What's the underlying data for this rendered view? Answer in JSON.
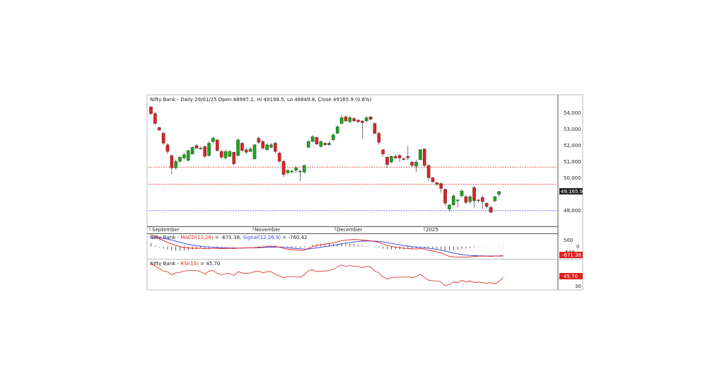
{
  "header": {
    "title": "Nifty Bank - Daily 29/01/25 Open 48997.2, Hi 49198.5, Lo 48849.8, Close 49165.9 (0.6%)"
  },
  "price_panel": {
    "y_ticks": [
      "54,000",
      "53,000",
      "52,000",
      "51,000",
      "50,000",
      "48,000"
    ],
    "last_price_label": "49,165.9"
  },
  "x_axis": {
    "labels": [
      "September",
      "November",
      "December",
      "2025"
    ]
  },
  "macd_panel": {
    "prefix": "Nifty Bank - ",
    "macd_label": "MACD(12,26)",
    "macd_value": " = -671.38, ",
    "signal_label": "Signal(12,26,9)",
    "signal_value": " = -760.42",
    "y_ticks": [
      "500",
      "0",
      "-500"
    ],
    "badge": "-671.38"
  },
  "rsi_panel": {
    "prefix": "Nifty Bank - ",
    "rsi_label": "RSI(15)",
    "rsi_value": " = 45.70",
    "y_ticks": [
      "30"
    ],
    "badge": "45.70"
  },
  "colors": {
    "up": "#19a619",
    "down": "#e02020",
    "macd": "#e02020",
    "signal": "#3b3bdf",
    "rsi": "#e02020",
    "ref_red": "#e02020",
    "ref_blue": "#3b3bdf",
    "badge_bg": "#e02020",
    "price_badge_bg": "#222222"
  },
  "chart_data": [
    {
      "type": "candlestick",
      "title": "Nifty Bank - Daily 29/01/25 Open 48997.2, Hi 49198.5, Lo 48849.8, Close 49165.9 (0.6%)",
      "ylim": [
        47050,
        55000
      ],
      "reference_lines": [
        {
          "value": 50650,
          "color": "red",
          "style": "dotted"
        },
        {
          "value": 49600,
          "color": "red",
          "style": "dotted"
        },
        {
          "value": 48000,
          "color": "blue",
          "style": "dotted"
        }
      ],
      "candles": [
        [
          54300,
          53900,
          54350,
          53800
        ],
        [
          53900,
          53300,
          54000,
          53200
        ],
        [
          53050,
          52900,
          53100,
          52850
        ],
        [
          52700,
          52100,
          52800,
          52000
        ],
        [
          52000,
          51600,
          52100,
          51450
        ],
        [
          51350,
          50600,
          51400,
          50200
        ],
        [
          50600,
          51000,
          51100,
          50500
        ],
        [
          51000,
          51250,
          51300,
          50900
        ],
        [
          51200,
          51400,
          51500,
          51100
        ],
        [
          51050,
          51650,
          51700,
          51000
        ],
        [
          51450,
          51850,
          51900,
          51400
        ],
        [
          51950,
          51800,
          52050,
          51750
        ],
        [
          51750,
          51800,
          51900,
          51700
        ],
        [
          51900,
          51300,
          51950,
          51200
        ],
        [
          51350,
          52100,
          52200,
          51300
        ],
        [
          52200,
          52400,
          52500,
          52100
        ],
        [
          52300,
          51650,
          52350,
          51600
        ],
        [
          51600,
          51250,
          51700,
          51150
        ],
        [
          51200,
          51600,
          51700,
          51100
        ],
        [
          51300,
          51600,
          51700,
          51250
        ],
        [
          51550,
          50850,
          51600,
          50750
        ],
        [
          51350,
          52300,
          52400,
          51300
        ],
        [
          52100,
          51650,
          52150,
          51600
        ],
        [
          51700,
          51550,
          51800,
          51450
        ],
        [
          51600,
          51750,
          51850,
          51550
        ],
        [
          51150,
          52000,
          52050,
          51100
        ],
        [
          52400,
          52150,
          52500,
          52050
        ],
        [
          52200,
          51800,
          52300,
          51700
        ],
        [
          51700,
          52000,
          52100,
          51650
        ],
        [
          51850,
          52000,
          52100,
          51800
        ],
        [
          52100,
          51600,
          52200,
          51500
        ],
        [
          51500,
          51000,
          51600,
          50900
        ],
        [
          51000,
          50200,
          51050,
          50050
        ],
        [
          50300,
          50450,
          50500,
          50200
        ],
        [
          50350,
          50400,
          50500,
          50250
        ],
        [
          50450,
          50600,
          50700,
          50300
        ],
        [
          50350,
          50400,
          50500,
          49800
        ],
        [
          50350,
          50750,
          50800,
          50250
        ],
        [
          51850,
          52200,
          52300,
          51800
        ],
        [
          52200,
          52500,
          52600,
          52150
        ],
        [
          52450,
          52050,
          52500,
          52000
        ],
        [
          51900,
          52200,
          52300,
          51850
        ],
        [
          52100,
          52000,
          52150,
          51950
        ],
        [
          52000,
          52100,
          52200,
          51950
        ],
        [
          52300,
          52600,
          52700,
          52250
        ],
        [
          52700,
          53100,
          53200,
          52650
        ],
        [
          53300,
          53650,
          53800,
          53250
        ],
        [
          53700,
          53450,
          53800,
          53400
        ],
        [
          53400,
          53650,
          53750,
          53350
        ],
        [
          53600,
          53450,
          53700,
          53400
        ],
        [
          53500,
          53400,
          53550,
          53350
        ],
        [
          53450,
          53350,
          53500,
          52400
        ],
        [
          53450,
          53650,
          53750,
          53400
        ],
        [
          53700,
          53550,
          53750,
          53500
        ],
        [
          53300,
          52700,
          53350,
          52650
        ],
        [
          52700,
          52150,
          52800,
          52000
        ],
        [
          51700,
          51450,
          51750,
          51300
        ],
        [
          51250,
          50800,
          51300,
          50600
        ],
        [
          50950,
          51300,
          51350,
          50900
        ],
        [
          51300,
          51200,
          51400,
          51150
        ],
        [
          51350,
          51200,
          51450,
          50950
        ],
        [
          51150,
          51100,
          51250,
          51050
        ],
        [
          51300,
          51200,
          51950,
          51050
        ],
        [
          50950,
          50750,
          51000,
          50650
        ],
        [
          50700,
          50950,
          51100,
          50350
        ],
        [
          51100,
          51700,
          51750,
          51050
        ],
        [
          51750,
          50750,
          51800,
          50650
        ],
        [
          50750,
          50000,
          50800,
          49800
        ],
        [
          50000,
          49750,
          50050,
          49700
        ],
        [
          49700,
          49600,
          49750,
          49500
        ],
        [
          49650,
          49350,
          49700,
          49100
        ],
        [
          49300,
          48450,
          49350,
          48300
        ],
        [
          48100,
          48350,
          48400,
          47950
        ],
        [
          48350,
          48900,
          49000,
          48300
        ],
        [
          48600,
          48650,
          48700,
          48200
        ],
        [
          48900,
          49200,
          49300,
          48800
        ],
        [
          48850,
          48500,
          48950,
          48400
        ],
        [
          48550,
          48850,
          48950,
          48400
        ],
        [
          49400,
          48600,
          49500,
          48200
        ],
        [
          48600,
          48650,
          48700,
          48500
        ],
        [
          48800,
          48550,
          48900,
          48100
        ],
        [
          48450,
          48250,
          48500,
          48150
        ],
        [
          48200,
          47900,
          48300,
          47850
        ],
        [
          48600,
          48850,
          48900,
          48500
        ],
        [
          48997.2,
          49165.9,
          49198.5,
          48849.8
        ]
      ]
    },
    {
      "type": "line",
      "title": "MACD(12,26) = -671.38, Signal(12,26,9) = -760.42",
      "ylim": [
        -900,
        900
      ],
      "series": [
        {
          "name": "MACD(12,26)",
          "values": [
            870,
            722,
            576,
            426,
            299,
            171,
            68,
            -19,
            -75,
            -115,
            -129,
            -126,
            -130,
            -162,
            -158,
            -137,
            -138,
            -152,
            -144,
            -130,
            -155,
            -122,
            -110,
            -105,
            -94,
            -85,
            -52,
            -39,
            -11,
            14,
            -1,
            -57,
            -140,
            -193,
            -232,
            -242,
            -278,
            -265,
            -140,
            -12,
            60,
            135,
            175,
            208,
            262,
            332,
            419,
            460,
            489,
            502,
            496,
            464,
            442,
            418,
            359,
            288,
            178,
            72,
            4,
            -44,
            -87,
            -138,
            -145,
            -180,
            -186,
            -150,
            -182,
            -262,
            -336,
            -402,
            -476,
            -600,
            -714,
            -758,
            -787,
            -779,
            -786,
            -767,
            -726,
            -710,
            -706,
            -703,
            -721,
            -699,
            -686,
            -671
          ]
        },
        {
          "name": "Signal(12,26,9)",
          "values": [
            630,
            648,
            634,
            592,
            533,
            461,
            382,
            302,
            227,
            158,
            101,
            56,
            19,
            -17,
            -45,
            -63,
            -78,
            -93,
            -103,
            -108,
            -118,
            -119,
            -117,
            -115,
            -110,
            -105,
            -94,
            -83,
            -69,
            -52,
            -42,
            -45,
            -64,
            -90,
            -118,
            -143,
            -170,
            -189,
            -179,
            -146,
            -105,
            -57,
            -10,
            34,
            80,
            130,
            188,
            242,
            290,
            333,
            365,
            385,
            396,
            400,
            392,
            371,
            332,
            280,
            225,
            171,
            119,
            68,
            26,
            -15,
            -50,
            -69,
            -92,
            -126,
            -168,
            -215,
            -267,
            -334,
            -410,
            -480,
            -541,
            -589,
            -628,
            -656,
            -670,
            -678,
            -683,
            -688,
            -694,
            -697,
            -699,
            -695
          ]
        },
        {
          "name": "Histogram",
          "values": [
            240,
            74,
            -58,
            -166,
            -234,
            -290,
            -314,
            -321,
            -302,
            -273,
            -230,
            -182,
            -149,
            -145,
            -113,
            -74,
            -60,
            -59,
            -41,
            -22,
            -37,
            -3,
            7,
            10,
            16,
            20,
            42,
            44,
            58,
            66,
            41,
            -12,
            -76,
            -103,
            -114,
            -99,
            -108,
            -76,
            39,
            134,
            165,
            192,
            185,
            174,
            182,
            202,
            231,
            218,
            199,
            169,
            131,
            79,
            46,
            18,
            -33,
            -83,
            -154,
            -208,
            -221,
            -215,
            -206,
            -206,
            -171,
            -165,
            -136,
            -81,
            -90,
            -136,
            -168,
            -187,
            -209,
            -266,
            -304,
            -278,
            -246,
            -190,
            -158,
            -111,
            -56,
            -32,
            -23,
            -15,
            -27,
            -2,
            13,
            24
          ]
        }
      ]
    },
    {
      "type": "line",
      "title": "RSI(15) = 45.70",
      "ylim": [
        25,
        75
      ],
      "series": [
        {
          "name": "RSI(15)",
          "values": [
            68,
            64,
            60,
            56,
            55,
            50,
            53,
            54,
            56,
            57,
            57,
            57,
            55,
            51,
            56,
            57,
            52,
            50,
            52,
            52,
            49,
            55,
            53,
            52,
            53,
            55,
            56,
            53,
            55,
            55,
            51,
            48,
            45,
            47,
            47,
            47,
            46,
            50,
            57,
            58,
            55,
            56,
            56,
            57,
            59,
            63,
            66,
            64,
            65,
            64,
            64,
            61,
            64,
            63,
            56,
            53,
            46,
            43,
            45,
            46,
            46,
            46,
            47,
            45,
            47,
            51,
            45,
            41,
            40,
            40,
            38,
            32,
            34,
            38,
            37,
            41,
            38,
            40,
            37,
            38,
            37,
            36,
            37,
            35,
            39,
            45.7
          ]
        }
      ]
    }
  ]
}
